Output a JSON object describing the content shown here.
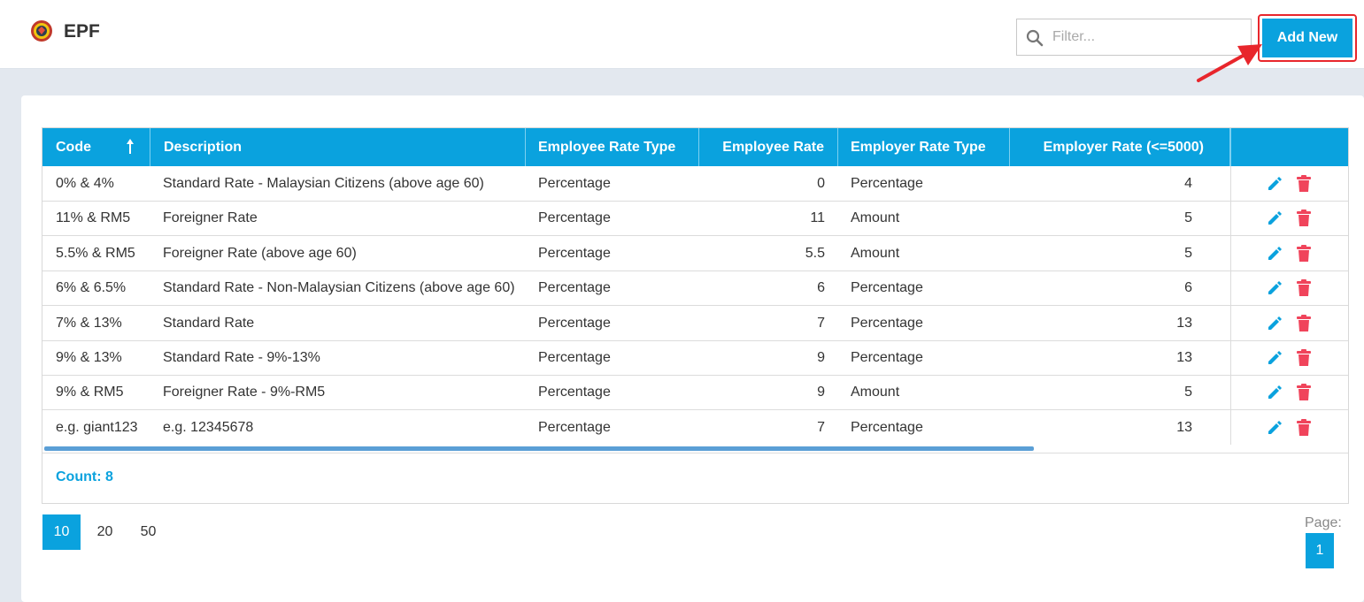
{
  "header": {
    "title": "EPF",
    "filter_placeholder": "Filter...",
    "add_new_label": "Add New"
  },
  "table": {
    "columns": [
      "Code",
      "Description",
      "Employee Rate Type",
      "Employee Rate",
      "Employer Rate Type",
      "Employer Rate (<=5000)"
    ],
    "sort": {
      "column": "Code",
      "direction": "ascending"
    },
    "rows": [
      {
        "code": "0% & 4%",
        "description": "Standard Rate - Malaysian Citizens (above age 60)",
        "employee_rate_type": "Percentage",
        "employee_rate": "0",
        "employer_rate_type": "Percentage",
        "employer_rate": "4"
      },
      {
        "code": "11% & RM5",
        "description": "Foreigner Rate",
        "employee_rate_type": "Percentage",
        "employee_rate": "11",
        "employer_rate_type": "Amount",
        "employer_rate": "5"
      },
      {
        "code": "5.5% & RM5",
        "description": "Foreigner Rate (above age 60)",
        "employee_rate_type": "Percentage",
        "employee_rate": "5.5",
        "employer_rate_type": "Amount",
        "employer_rate": "5"
      },
      {
        "code": "6% & 6.5%",
        "description": "Standard Rate - Non-Malaysian Citizens (above age 60)",
        "employee_rate_type": "Percentage",
        "employee_rate": "6",
        "employer_rate_type": "Percentage",
        "employer_rate": "6"
      },
      {
        "code": "7% & 13%",
        "description": "Standard Rate",
        "employee_rate_type": "Percentage",
        "employee_rate": "7",
        "employer_rate_type": "Percentage",
        "employer_rate": "13"
      },
      {
        "code": "9% & 13%",
        "description": "Standard Rate - 9%-13%",
        "employee_rate_type": "Percentage",
        "employee_rate": "9",
        "employer_rate_type": "Percentage",
        "employer_rate": "13"
      },
      {
        "code": "9% & RM5",
        "description": "Foreigner Rate - 9%-RM5",
        "employee_rate_type": "Percentage",
        "employee_rate": "9",
        "employer_rate_type": "Amount",
        "employer_rate": "5"
      },
      {
        "code": "e.g. giant123",
        "description": "e.g. 12345678",
        "employee_rate_type": "Percentage",
        "employee_rate": "7",
        "employer_rate_type": "Percentage",
        "employer_rate": "13"
      }
    ],
    "count_label": "Count: 8"
  },
  "pagination": {
    "page_sizes": [
      "10",
      "20",
      "50"
    ],
    "selected_page_size": "10",
    "page_label": "Page:",
    "current_page": "1"
  },
  "colors": {
    "accent": "#0aa2de",
    "delete": "#f0445b",
    "highlight": "#e8262c"
  },
  "icons": [
    "search-icon",
    "sort-ascending-icon",
    "edit-icon",
    "delete-icon",
    "logo-crest-icon",
    "annotation-arrow-icon"
  ]
}
